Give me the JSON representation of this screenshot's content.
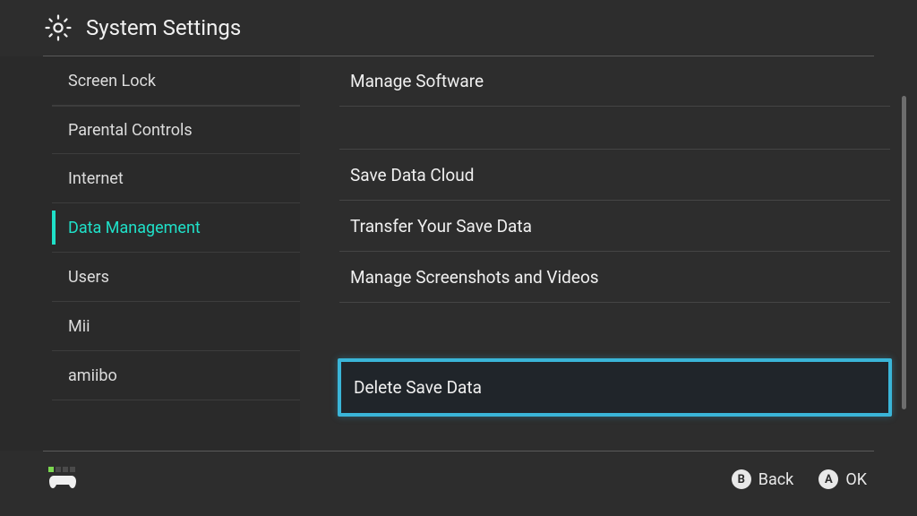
{
  "header": {
    "title": "System Settings"
  },
  "sidebar": {
    "items": [
      {
        "label": "Screen Lock",
        "active": false
      },
      {
        "label": "Parental Controls",
        "active": false
      },
      {
        "label": "Internet",
        "active": false
      },
      {
        "label": "Data Management",
        "active": true
      },
      {
        "label": "Users",
        "active": false
      },
      {
        "label": "Mii",
        "active": false
      },
      {
        "label": "amiibo",
        "active": false
      }
    ]
  },
  "main": {
    "groups": [
      {
        "items": [
          "Manage Software"
        ]
      },
      {
        "items": [
          "Save Data Cloud",
          "Transfer Your Save Data",
          "Manage Screenshots and Videos"
        ]
      },
      {
        "items": [
          "Delete Save Data"
        ],
        "highlighted_index": 0
      }
    ]
  },
  "footer": {
    "back": {
      "button": "B",
      "label": "Back"
    },
    "ok": {
      "button": "A",
      "label": "OK"
    }
  }
}
